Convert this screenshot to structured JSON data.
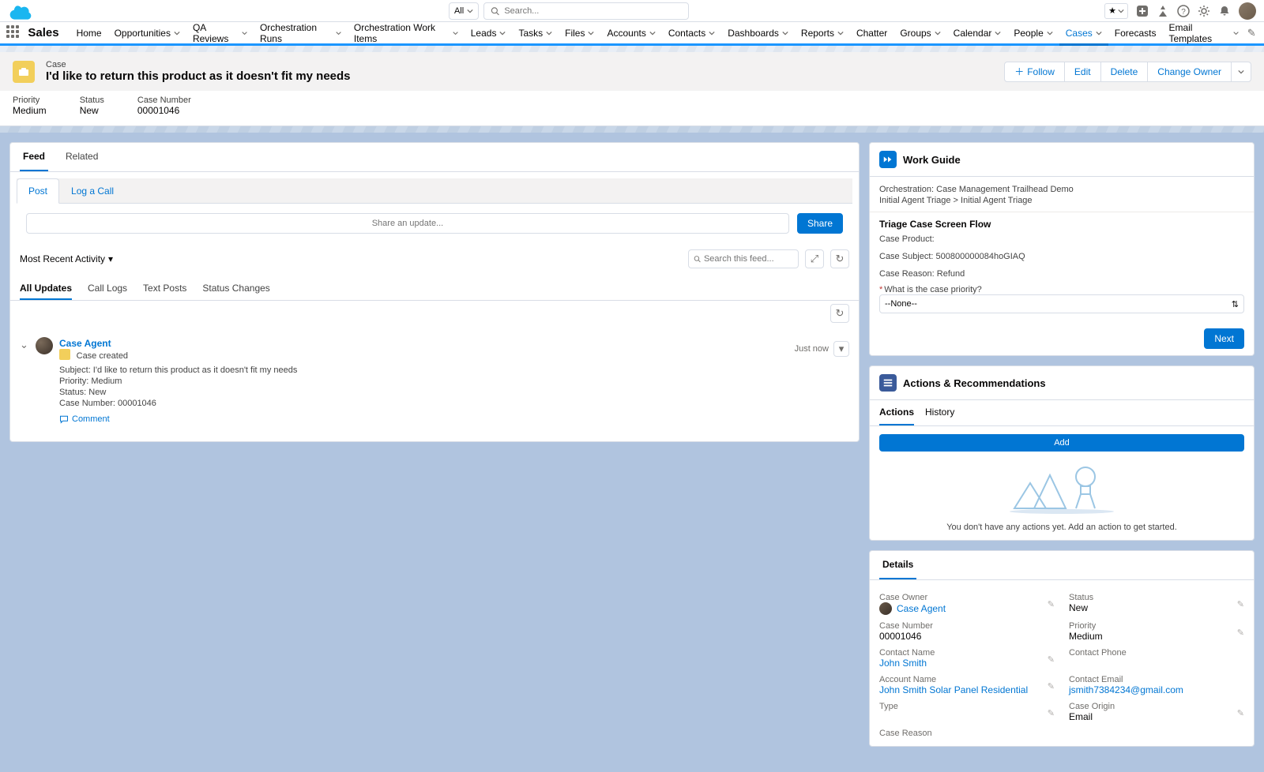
{
  "header": {
    "search_scope": "All",
    "search_placeholder": "Search..."
  },
  "nav": {
    "app_name": "Sales",
    "items": [
      {
        "label": "Home",
        "menu": false
      },
      {
        "label": "Opportunities",
        "menu": true
      },
      {
        "label": "QA Reviews",
        "menu": true
      },
      {
        "label": "Orchestration Runs",
        "menu": true
      },
      {
        "label": "Orchestration Work Items",
        "menu": true
      },
      {
        "label": "Leads",
        "menu": true
      },
      {
        "label": "Tasks",
        "menu": true
      },
      {
        "label": "Files",
        "menu": true
      },
      {
        "label": "Accounts",
        "menu": true
      },
      {
        "label": "Contacts",
        "menu": true
      },
      {
        "label": "Dashboards",
        "menu": true
      },
      {
        "label": "Reports",
        "menu": true
      },
      {
        "label": "Chatter",
        "menu": false
      },
      {
        "label": "Groups",
        "menu": true
      },
      {
        "label": "Calendar",
        "menu": true
      },
      {
        "label": "People",
        "menu": true
      },
      {
        "label": "Cases",
        "menu": true,
        "active": true
      },
      {
        "label": "Forecasts",
        "menu": false
      },
      {
        "label": "Email Templates",
        "menu": true
      }
    ]
  },
  "record": {
    "object_label": "Case",
    "title": "I'd like to return this product as it doesn't fit my needs",
    "actions": {
      "follow": "Follow",
      "edit": "Edit",
      "delete": "Delete",
      "change_owner": "Change Owner"
    },
    "fields": {
      "priority_label": "Priority",
      "priority_value": "Medium",
      "status_label": "Status",
      "status_value": "New",
      "casenum_label": "Case Number",
      "casenum_value": "00001046"
    }
  },
  "left": {
    "tabs": {
      "feed": "Feed",
      "related": "Related"
    },
    "publisher": {
      "post": "Post",
      "log_call": "Log a Call",
      "placeholder": "Share an update...",
      "share": "Share"
    },
    "sort": "Most Recent Activity",
    "search_placeholder": "Search this feed...",
    "filters": {
      "all": "All Updates",
      "calls": "Call Logs",
      "text": "Text Posts",
      "status": "Status Changes"
    },
    "feed_item": {
      "author": "Case Agent",
      "event": "Case created",
      "subject": "Subject: I'd like to return this product as it doesn't fit my needs",
      "priority": "Priority: Medium",
      "status": "Status: New",
      "casenum": "Case Number: 00001046",
      "time": "Just now",
      "comment": "Comment"
    }
  },
  "work_guide": {
    "title": "Work Guide",
    "orch_line": "Orchestration: Case Management Trailhead Demo",
    "path_line": "Initial Agent Triage > Initial Agent Triage",
    "flow_title": "Triage Case Screen Flow",
    "product": "Case Product:",
    "subject": "Case Subject: 500800000084hoGIAQ",
    "reason": "Case Reason: Refund",
    "q_label": "What is the case priority?",
    "select_value": "--None--",
    "next": "Next"
  },
  "actions_card": {
    "title": "Actions & Recommendations",
    "tab_actions": "Actions",
    "tab_history": "History",
    "add": "Add",
    "empty": "You don't have any actions yet. Add an action to get started."
  },
  "details": {
    "title": "Details",
    "owner_label": "Case Owner",
    "owner_value": "Case Agent",
    "status_label": "Status",
    "status_value": "New",
    "casenum_label": "Case Number",
    "casenum_value": "00001046",
    "priority_label": "Priority",
    "priority_value": "Medium",
    "contact_label": "Contact Name",
    "contact_value": "John Smith",
    "phone_label": "Contact Phone",
    "phone_value": "",
    "account_label": "Account Name",
    "account_value": "John Smith Solar Panel Residential",
    "email_label": "Contact Email",
    "email_value": "jsmith7384234@gmail.com",
    "type_label": "Type",
    "type_value": "",
    "origin_label": "Case Origin",
    "origin_value": "Email",
    "creason_label": "Case Reason",
    "creason_value": ""
  }
}
